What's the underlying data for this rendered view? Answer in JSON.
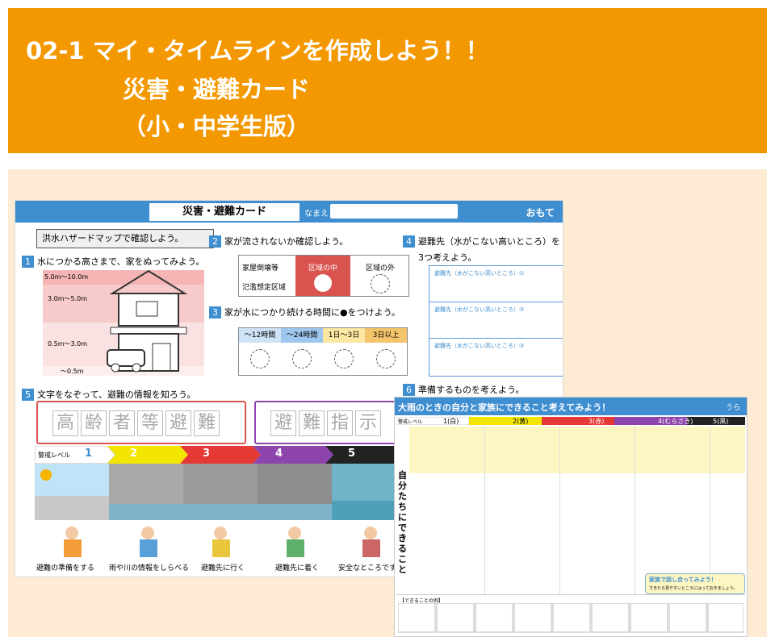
{
  "header": {
    "line1": "02-1 マイ・タイムラインを作成しよう！！",
    "line2": "災害・避難カード",
    "line3": "（小・中学生版）",
    "bg_color": "#f39800"
  },
  "front_card": {
    "title": "災害・避難カード",
    "name_label": "なまえ",
    "side_label": "おもて",
    "section1_box": "洪水ハザードマップで確認しよう。",
    "q1": "水につかる高さまで、家をぬってみよう。",
    "depths": [
      "5.0m〜10.0m",
      "3.0m〜5.0m",
      "0.5m〜3.0m",
      "〜0.5m"
    ],
    "q2": "家が流されないか確認しよう。",
    "q2_table": {
      "row_labels": [
        "家屋倒壊等",
        "氾濫想定区域"
      ],
      "inside": "区域の中",
      "outside": "区域の外"
    },
    "q3": "家が水につかり続ける時間に●をつけよう。",
    "q3_options": [
      "〜12時間",
      "〜24時間",
      "1日〜3日",
      "3日以上"
    ],
    "q4": "避難先（水がこない高いところ）を",
    "q4b": "3つ考えよう。",
    "q4_rows": [
      "避難先（水がこない高いところ）①",
      "避難先（水がこない高いところ）②",
      "避難先（水がこない高いところ）③"
    ],
    "q5": "文字をなぞって、避難の情報を知ろう。",
    "q5_words_red": [
      "高",
      "齢",
      "者",
      "等",
      "避",
      "難"
    ],
    "q5_words_purple": [
      "避",
      "難",
      "指",
      "示"
    ],
    "q6": "準備するものを考えよう。",
    "level_label": "警戒レベル",
    "levels": [
      "1",
      "2",
      "3",
      "4",
      "5"
    ],
    "actions": [
      "避難の準備をする",
      "雨や川の情報をしらべる",
      "避難先に行く",
      "避難先に着く",
      "安全なところですごす"
    ]
  },
  "back_card": {
    "title": "大雨のときの自分と家族にできること考えてみよう！",
    "side_label": "うら",
    "level_label": "警戒レベル",
    "level_heads": [
      "1(白)",
      "2(黄)",
      "3(赤)",
      "4(むらさき)",
      "5(黒)"
    ],
    "vertical_label": "自分たちにできること",
    "examples_label": "【できることの例】",
    "family_note": "家族で話し合ってみよう！",
    "family_sub": "できたら見やすいところにはっておきましょう。"
  }
}
